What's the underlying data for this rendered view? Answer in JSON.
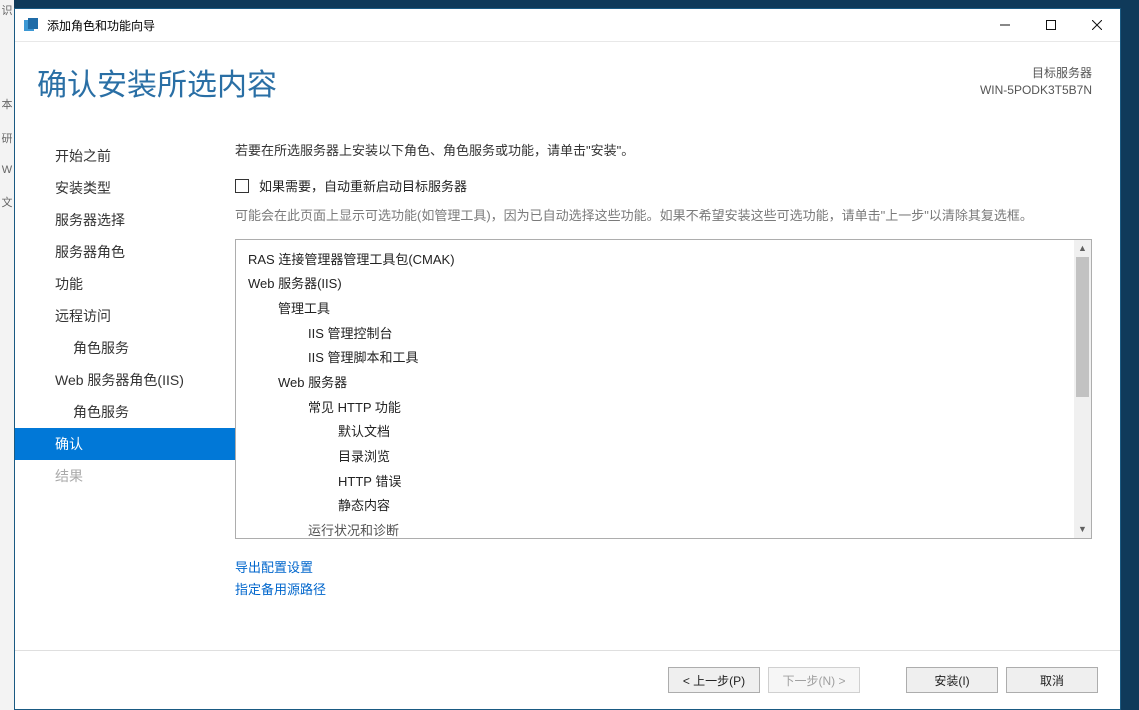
{
  "window": {
    "title": "添加角色和功能向导"
  },
  "header": {
    "page_title": "确认安装所选内容",
    "target_label": "目标服务器",
    "target_server": "WIN-5PODK3T5B7N"
  },
  "sidebar": {
    "items": [
      {
        "label": "开始之前",
        "indent": false,
        "selected": false,
        "disabled": false,
        "name": "nav-before-you-begin"
      },
      {
        "label": "安装类型",
        "indent": false,
        "selected": false,
        "disabled": false,
        "name": "nav-installation-type"
      },
      {
        "label": "服务器选择",
        "indent": false,
        "selected": false,
        "disabled": false,
        "name": "nav-server-selection"
      },
      {
        "label": "服务器角色",
        "indent": false,
        "selected": false,
        "disabled": false,
        "name": "nav-server-roles"
      },
      {
        "label": "功能",
        "indent": false,
        "selected": false,
        "disabled": false,
        "name": "nav-features"
      },
      {
        "label": "远程访问",
        "indent": false,
        "selected": false,
        "disabled": false,
        "name": "nav-remote-access"
      },
      {
        "label": "角色服务",
        "indent": true,
        "selected": false,
        "disabled": false,
        "name": "nav-ra-role-services"
      },
      {
        "label": "Web 服务器角色(IIS)",
        "indent": false,
        "selected": false,
        "disabled": false,
        "name": "nav-web-server-iis"
      },
      {
        "label": "角色服务",
        "indent": true,
        "selected": false,
        "disabled": false,
        "name": "nav-iis-role-services"
      },
      {
        "label": "确认",
        "indent": false,
        "selected": true,
        "disabled": false,
        "name": "nav-confirmation"
      },
      {
        "label": "结果",
        "indent": false,
        "selected": false,
        "disabled": true,
        "name": "nav-results"
      }
    ]
  },
  "main": {
    "instruction": "若要在所选服务器上安装以下角色、角色服务或功能，请单击\"安装\"。",
    "checkbox_label": "如果需要，自动重新启动目标服务器",
    "note": "可能会在此页面上显示可选功能(如管理工具)，因为已自动选择这些功能。如果不希望安装这些可选功能，请单击\"上一步\"以清除其复选框。",
    "tree": [
      {
        "level": 0,
        "text": "RAS 连接管理器管理工具包(CMAK)"
      },
      {
        "level": 0,
        "text": "Web 服务器(IIS)"
      },
      {
        "level": 1,
        "text": "管理工具"
      },
      {
        "level": 2,
        "text": "IIS 管理控制台"
      },
      {
        "level": 2,
        "text": "IIS 管理脚本和工具"
      },
      {
        "level": 1,
        "text": "Web 服务器"
      },
      {
        "level": 2,
        "text": "常见 HTTP 功能"
      },
      {
        "level": 3,
        "text": "默认文档"
      },
      {
        "level": 3,
        "text": "目录浏览"
      },
      {
        "level": 3,
        "text": "HTTP 错误"
      },
      {
        "level": 3,
        "text": "静态内容"
      },
      {
        "level": 2,
        "text": "运行状况和诊断",
        "cut": true
      }
    ],
    "link_export": "导出配置设置",
    "link_alt_source": "指定备用源路径"
  },
  "footer": {
    "previous": "< 上一步(P)",
    "next": "下一步(N) >",
    "install": "安装(I)",
    "cancel": "取消"
  },
  "left_edge_chars": [
    "识",
    "",
    "本",
    "研",
    "W",
    "文"
  ]
}
